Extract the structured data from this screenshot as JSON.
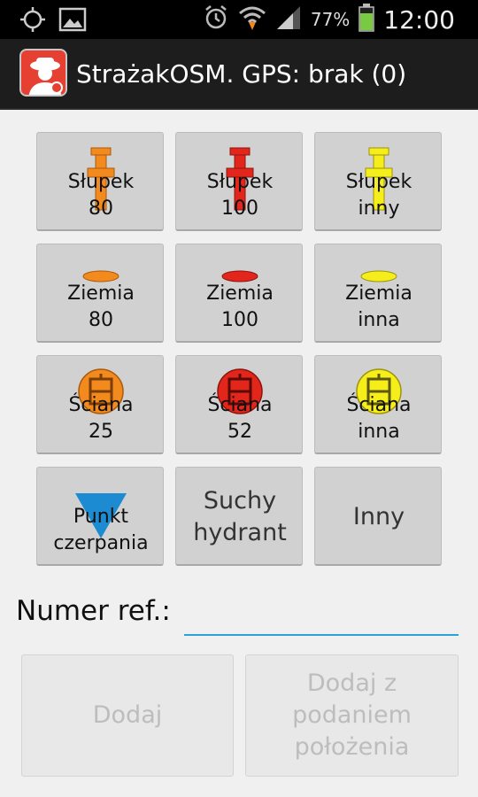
{
  "status_bar": {
    "battery_percent": "77%",
    "time": "12:00"
  },
  "app": {
    "title": "StrażakOSM. GPS: brak (0)"
  },
  "buttons": [
    {
      "line1": "Słupek",
      "line2": "80"
    },
    {
      "line1": "Słupek",
      "line2": "100"
    },
    {
      "line1": "Słupek",
      "line2": "inny"
    },
    {
      "line1": "Ziemia",
      "line2": "80"
    },
    {
      "line1": "Ziemia",
      "line2": "100"
    },
    {
      "line1": "Ziemia",
      "line2": "inna"
    },
    {
      "line1": "Ściana",
      "line2": "25"
    },
    {
      "line1": "Ściana",
      "line2": "52"
    },
    {
      "line1": "Ściana",
      "line2": "inna"
    },
    {
      "line1": "Punkt",
      "line2": "czerpania"
    },
    {
      "line1": "Suchy",
      "line2": "hydrant"
    },
    {
      "line1": "Inny"
    }
  ],
  "colors": {
    "orange": "#f28a1e",
    "red": "#e3261c",
    "yellow": "#f6ee1a",
    "blue": "#1c8bd1",
    "accent": "#2aa4d8"
  },
  "ref": {
    "label": "Numer ref.:",
    "value": ""
  },
  "actions": {
    "add": "Dodaj",
    "add_pos_line1": "Dodaj z",
    "add_pos_line2": "podaniem",
    "add_pos_line3": "położenia"
  },
  "icons": {
    "status_left": [
      "gps-icon",
      "image-icon"
    ],
    "status_right": [
      "alarm-icon",
      "wifi-icon",
      "signal-icon",
      "battery-icon"
    ],
    "app": "firefighter-icon"
  }
}
